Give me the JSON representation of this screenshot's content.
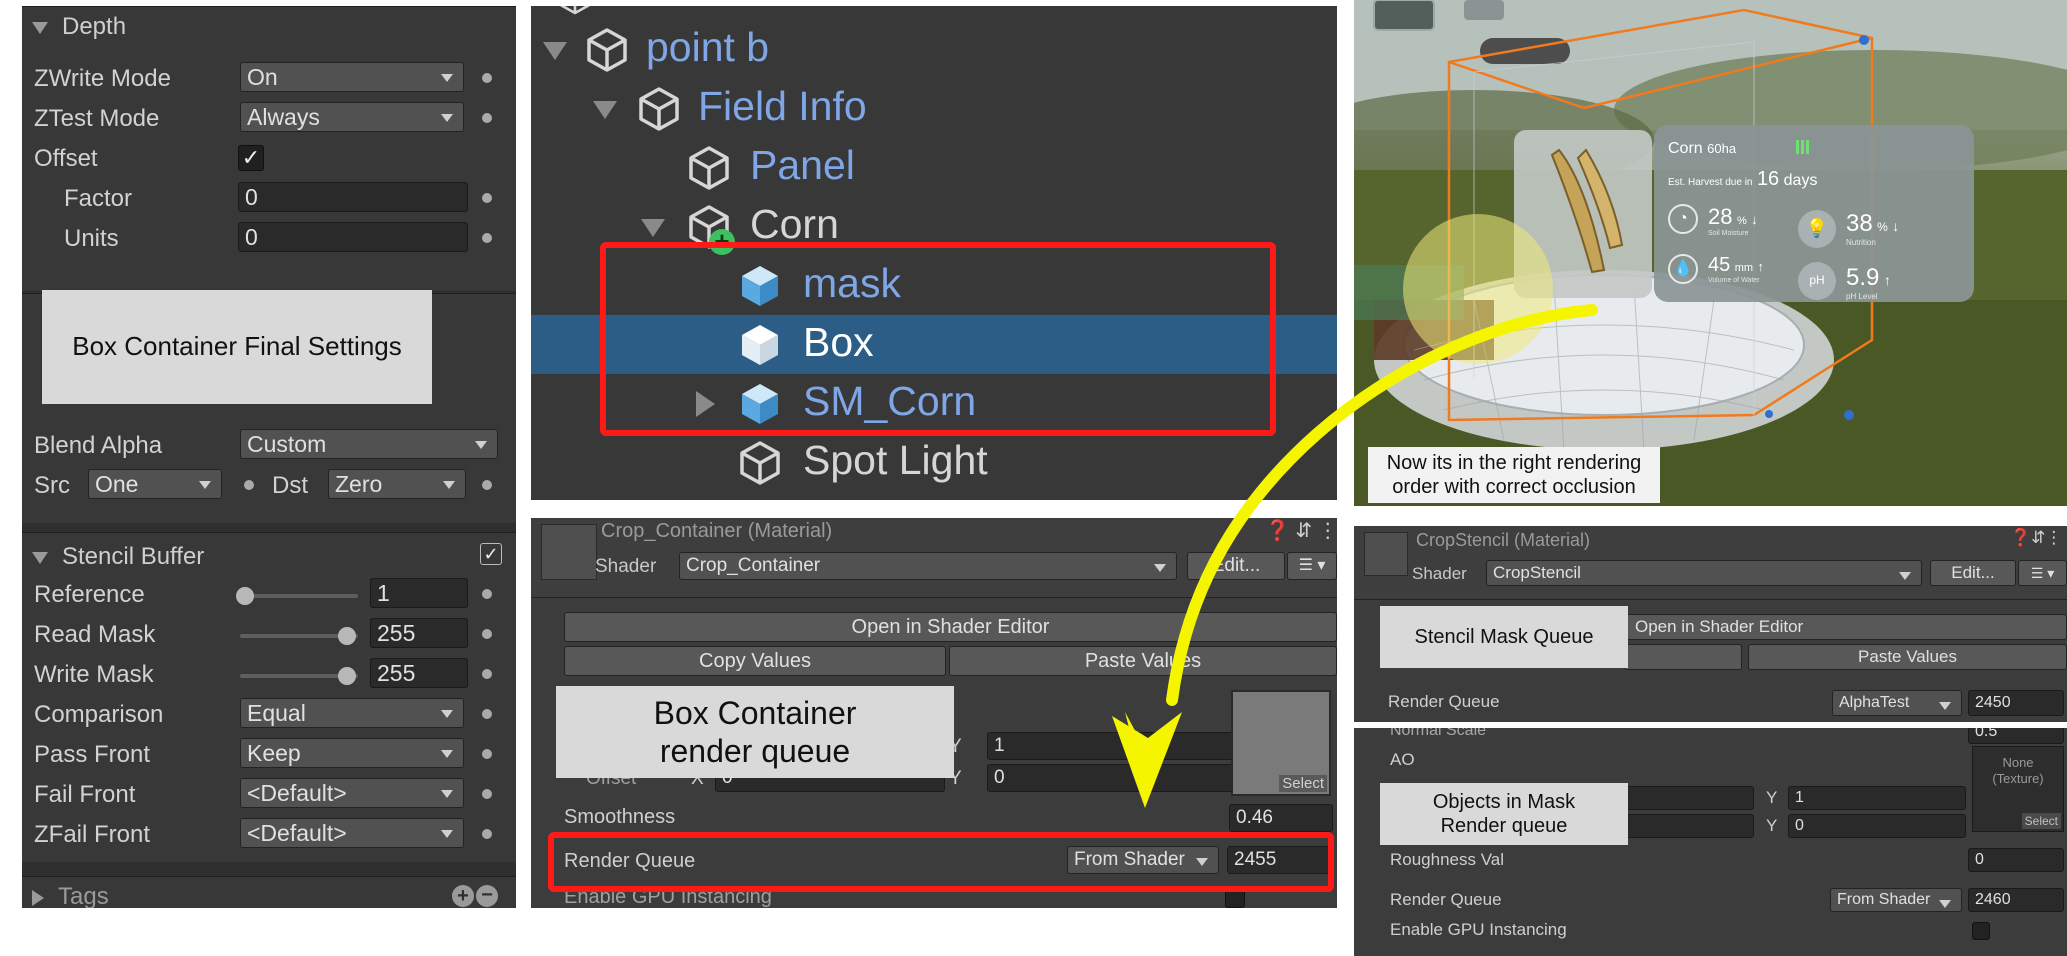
{
  "shader_panel": {
    "depth_title": "Depth",
    "zwrite_label": "ZWrite Mode",
    "zwrite_value": "On",
    "ztest_label": "ZTest Mode",
    "ztest_value": "Always",
    "offset_label": "Offset",
    "offset_checked": true,
    "factor_label": "Factor",
    "factor_value": "0",
    "units_label": "Units",
    "units_value": "0",
    "blend_alpha_label": "Blend Alpha",
    "blend_alpha_value": "Custom",
    "src_label": "Src",
    "src_value": "One",
    "dst_label": "Dst",
    "dst_value": "Zero",
    "stencil_title": "Stencil Buffer",
    "reference_label": "Reference",
    "reference_value": "1",
    "read_mask_label": "Read Mask",
    "read_mask_value": "255",
    "write_mask_label": "Write Mask",
    "write_mask_value": "255",
    "comparison_label": "Comparison",
    "comparison_value": "Equal",
    "pass_front_label": "Pass Front",
    "pass_front_value": "Keep",
    "fail_front_label": "Fail Front",
    "fail_front_value": "<Default>",
    "zfail_front_label": "ZFail Front",
    "zfail_front_value": "<Default>",
    "tags_title": "Tags"
  },
  "callouts": {
    "box_final": "Box Container Final Settings",
    "box_queue_1": "Box Container",
    "box_queue_2": "render queue",
    "stencil_queue": "Stencil Mask Queue",
    "objects_queue_1": "Objects in Mask",
    "objects_queue_2": "Render queue"
  },
  "hierarchy": {
    "items": [
      {
        "label": "point b"
      },
      {
        "label": "Field Info"
      },
      {
        "label": "Panel"
      },
      {
        "label": "Corn"
      },
      {
        "label": "mask"
      },
      {
        "label": "Box"
      },
      {
        "label": "SM_Corn"
      },
      {
        "label": "Spot Light"
      }
    ]
  },
  "crop_container": {
    "title": "Crop_Container (Material)",
    "shader_label": "Shader",
    "shader_value": "Crop_Container",
    "edit_label": "Edit...",
    "open_editor": "Open in Shader Editor",
    "copy_values": "Copy Values",
    "paste_values": "Paste Values",
    "offset_label": "Offset",
    "tiling_y": "1",
    "offset_x": "0",
    "offset_y": "0",
    "x_label": "X",
    "y_label": "Y",
    "select_label": "Select",
    "smoothness_label": "Smoothness",
    "smoothness_value": "0.46",
    "render_queue_label": "Render Queue",
    "render_queue_mode": "From Shader",
    "render_queue_value": "2455",
    "gpu_label": "Enable GPU Instancing"
  },
  "crop_stencil": {
    "title": "CropStencil (Material)",
    "shader_label": "Shader",
    "shader_value": "CropStencil",
    "edit_label": "Edit...",
    "open_editor": "Open in Shader Editor",
    "paste_values": "Paste Values",
    "render_queue_label": "Render Queue",
    "render_queue_mode": "AlphaTest",
    "render_queue_value": "2450"
  },
  "objects_material": {
    "normal_scale_label": "Normal Scale",
    "normal_scale_value": "0.5",
    "ao_label": "AO",
    "texture_none_1": "None",
    "texture_none_2": "(Texture)",
    "select_label": "Select",
    "tiling_y": "1",
    "offset_y": "0",
    "y_label": "Y",
    "roughness_label": "Roughness Val",
    "roughness_value": "0",
    "render_queue_label": "Render Queue",
    "render_queue_mode": "From Shader",
    "render_queue_value": "2460",
    "gpu_label": "Enable GPU Instancing"
  },
  "scene": {
    "caption_1": "Now its in the right rendering",
    "caption_2": "order with correct occlusion",
    "card_title": "Corn",
    "card_area": "60ha",
    "card_harvest_prefix": "Est. Harvest due in",
    "card_harvest_days": "16",
    "card_harvest_unit": "days",
    "soil_value": "28",
    "soil_unit": "%",
    "soil_label": "Soil Moisture",
    "nutrition_value": "38",
    "nutrition_unit": "%",
    "nutrition_label": "Nutrition",
    "water_value": "45",
    "water_unit": "mm",
    "water_label": "Volume of Water",
    "ph_value": "5.9",
    "ph_label": "pH Level"
  },
  "colors": {
    "highlight_red": "#ff1a1a",
    "arrow_yellow": "#f5f500",
    "selection_blue": "#2c5d87",
    "prefab_blue": "#5aa9e0",
    "go_name_blue": "#7fa6e6"
  },
  "icons": [
    "chevron-down-icon",
    "gameobject-cube-icon",
    "prefab-cube-icon",
    "add-badge-icon",
    "checkmark-icon",
    "help-icon",
    "settings-sliders-icon",
    "more-vert-icon",
    "plus-icon",
    "minus-icon",
    "arrow-icon"
  ]
}
